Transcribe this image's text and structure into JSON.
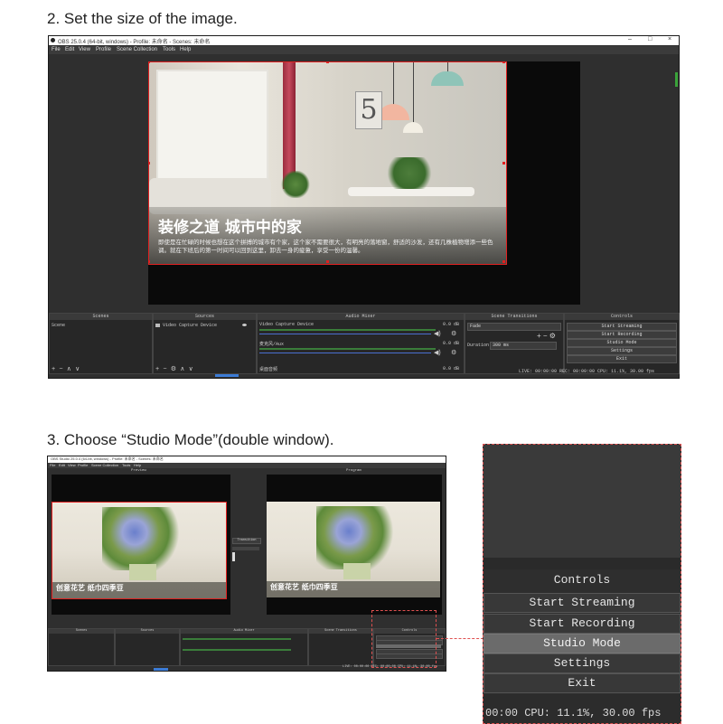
{
  "step2": {
    "heading": "2. Set the size of the image.",
    "window_title": "OBS 25.0.4 (64-bit, windows) - Profile: 未命名 - Scenes: 未命名",
    "window_controls": [
      "–",
      "□",
      "×"
    ],
    "menu": [
      "File",
      "Edit",
      "View",
      "Profile",
      "Scene Collection",
      "Tools",
      "Help"
    ],
    "image": {
      "title": "装修之道  城市中的家",
      "caption": "即使是在忙碌的时候也想在这个拼搏的城市有个家，这个家不需要很大，有明亮的落地窗，舒适的沙发，还有几株植物增添一些色调。就在下班后的第一时间可以回到这里，卸去一身的疲惫，享受一份的温馨。",
      "wall_number": "5"
    },
    "docks": {
      "scenes": {
        "title": "Scenes",
        "item": "Scene"
      },
      "sources": {
        "title": "Sources",
        "item": "Video Capture Device"
      },
      "mixer": {
        "title": "Audio Mixer",
        "channels": [
          {
            "name": "Video Capture Device",
            "db": "0.0 dB"
          },
          {
            "name": "麦克风/Aux",
            "db": "0.0 dB"
          },
          {
            "name": "桌面音频",
            "db": "0.0 dB"
          }
        ]
      },
      "transitions": {
        "title": "Scene Transitions",
        "type": "Fade",
        "duration_label": "Duration",
        "duration_value": "300 ms"
      },
      "controls": {
        "title": "Controls",
        "buttons": [
          "Start Streaming",
          "Start Recording",
          "Studio Mode",
          "Settings",
          "Exit"
        ]
      }
    },
    "status": "LIVE: 00:00:00    REC: 00:00:00    CPU: 11.1%, 30.00 fps"
  },
  "step3": {
    "heading": "3. Choose “Studio Mode”(double window).",
    "window_title": "OBS Studio 25.0.4 (64-bit, windows) - Profile: 未命名 - Scenes: 未命名",
    "menu": [
      "File",
      "Edit",
      "View",
      "Profile",
      "Scene Collection",
      "Tools",
      "Help"
    ],
    "preview_label": "Preview",
    "program_label": "Program",
    "transition_label": "Transition",
    "image_title": "创意花艺  纸巾四季豆",
    "docks": {
      "scenes": "Scenes",
      "sources": "Sources",
      "mixer": "Audio Mixer",
      "transitions": "Scene Transitions",
      "controls": "Controls"
    },
    "status": "LIVE: 00:00:00   REC: 00:00:00   CPU: 11.1%, 30.00 fps"
  },
  "zoom": {
    "title": "Controls",
    "buttons": [
      "Start Streaming",
      "Start Recording",
      "Studio Mode",
      "Settings",
      "Exit"
    ],
    "status": "00:00    CPU: 11.1%, 30.00 fps"
  }
}
